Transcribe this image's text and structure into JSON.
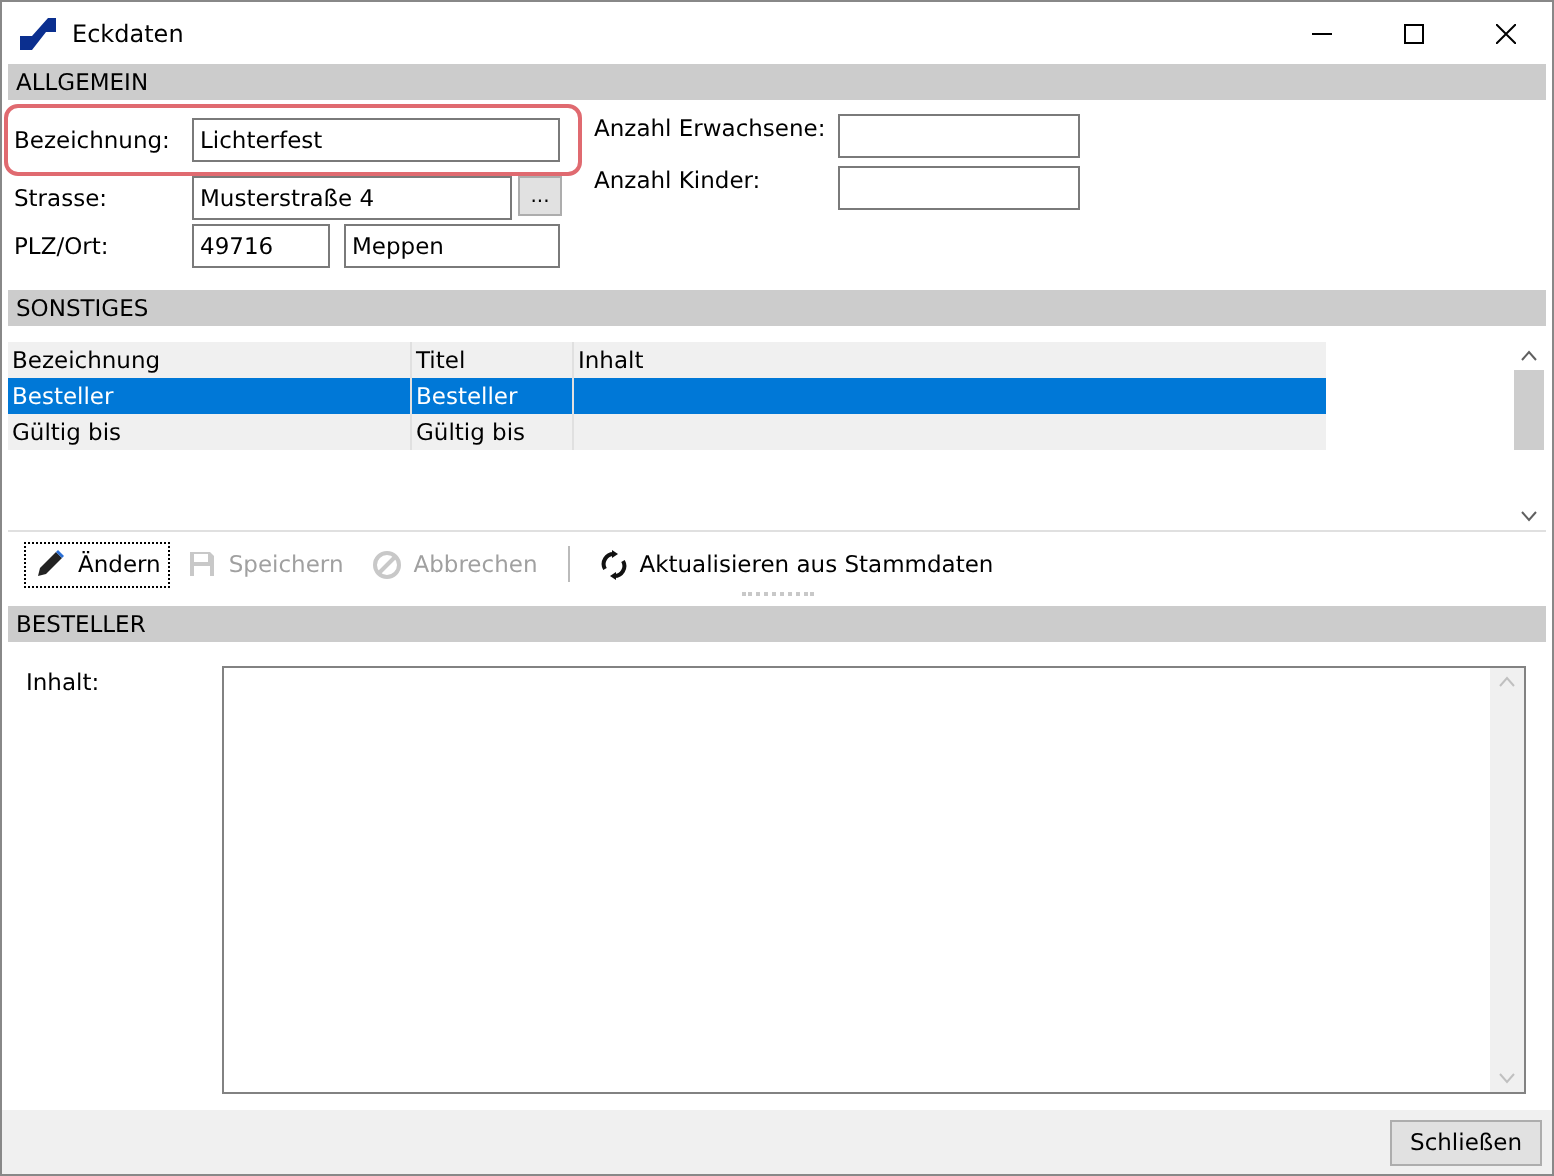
{
  "window": {
    "title": "Eckdaten"
  },
  "allgemein": {
    "header": "ALLGEMEIN",
    "left": [
      {
        "label": "Bezeichnung:",
        "values": [
          "Lichterfest"
        ],
        "highlighted": true
      },
      {
        "label": "Strasse:",
        "values": [
          "Musterstraße 4"
        ],
        "button": "...",
        "highlighted": false
      },
      {
        "label": "PLZ/Ort:",
        "values": [
          "49716",
          "Meppen"
        ],
        "highlighted": false
      }
    ],
    "right": [
      {
        "label": "Anzahl Erwachsene:"
      },
      {
        "label": "Anzahl Kinder:"
      }
    ]
  },
  "sonstiges": {
    "header": "SONSTIGES",
    "columns": [
      "Bezeichnung",
      "Titel",
      "Inhalt"
    ],
    "rows": [
      {
        "cells": [
          "Besteller",
          "Besteller"
        ],
        "selected": true
      },
      {
        "cells": [
          "Gültig bis",
          "Gültig bis"
        ],
        "selected": false
      }
    ]
  },
  "toolbar": [
    {
      "kind": "edit",
      "label": "Ändern",
      "disabled": false,
      "focused": true
    },
    {
      "kind": "save",
      "label": "Speichern",
      "disabled": true,
      "focused": false
    },
    {
      "kind": "cancel",
      "label": "Abbrechen",
      "disabled": true,
      "focused": false
    },
    {
      "kind": "refresh",
      "label": "Aktualisieren aus Stammdaten",
      "disabled": false,
      "focused": false
    }
  ],
  "besteller": {
    "header": "BESTELLER",
    "label": "Inhalt:"
  },
  "footer": {
    "button": "Schließen"
  }
}
